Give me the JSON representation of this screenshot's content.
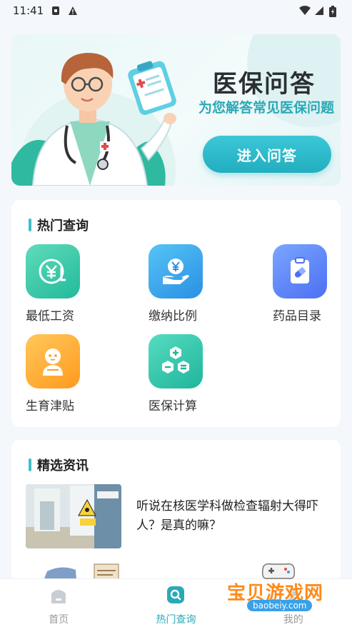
{
  "status_bar": {
    "time": "11:41"
  },
  "banner": {
    "title": "医保问答",
    "subtitle": "为您解答常见医保问题",
    "button_label": "进入问答"
  },
  "hot": {
    "title": "热门查询",
    "items": [
      {
        "label": "最低工资",
        "icon": "yen-coin-icon"
      },
      {
        "label": "缴纳比例",
        "icon": "yen-hand-icon"
      },
      {
        "label": "药品目录",
        "icon": "medicine-clipboard-icon"
      },
      {
        "label": "生育津贴",
        "icon": "baby-icon"
      },
      {
        "label": "医保计算",
        "icon": "calculator-hexagon-icon"
      }
    ]
  },
  "news": {
    "title": "精选资讯",
    "items": [
      {
        "headline": "听说在核医学科做检查辐射大得吓人？是真的嘛？"
      }
    ]
  },
  "bottom_nav": {
    "items": [
      {
        "label": "首页",
        "active": false
      },
      {
        "label": "热门查询",
        "active": true
      },
      {
        "label": "我的",
        "active": false
      }
    ]
  },
  "watermark": {
    "text": "宝贝游戏网",
    "url": "baobeiy.com"
  },
  "colors": {
    "accent": "#2aa9b5",
    "card_bg": "#ffffff",
    "page_bg": "#f4f7fb"
  }
}
